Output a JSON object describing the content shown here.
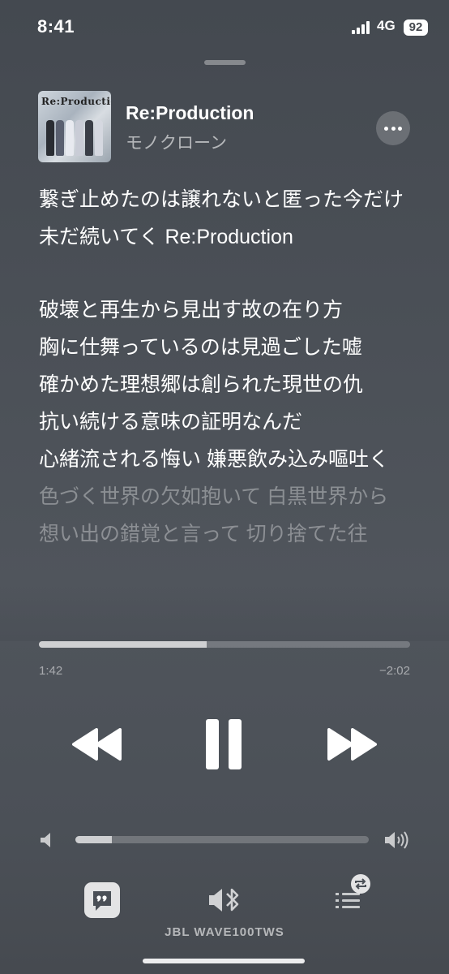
{
  "status_bar": {
    "time": "8:41",
    "network": "4G",
    "battery": "92"
  },
  "now_playing": {
    "artwork_text": "Re:Production",
    "title": "Re:Production",
    "artist": "モノクローン"
  },
  "lyrics": [
    {
      "text": "繋ぎ止めたのは譲れないと匿った今だけ",
      "state": "active"
    },
    {
      "text": "未だ続いてく Re:Production",
      "state": "active"
    },
    {
      "text": "",
      "state": "spacer"
    },
    {
      "text": "破壊と再生から見出す故の在り方",
      "state": "active"
    },
    {
      "text": "胸に仕舞っているのは見過ごした嘘",
      "state": "active"
    },
    {
      "text": "確かめた理想郷は創られた現世の仇",
      "state": "active"
    },
    {
      "text": "抗い続ける意味の証明なんだ",
      "state": "active"
    },
    {
      "text": "心緒流される悔い 嫌悪飲み込み嘔吐く",
      "state": "active"
    },
    {
      "text": "色づく世界の欠如抱いて 白黒世界から",
      "state": "dim"
    },
    {
      "text": "想い出の錯覚と言って 切り捨てた往",
      "state": "dim"
    }
  ],
  "playback": {
    "elapsed": "1:42",
    "remaining": "−2:02",
    "progress_fraction": 0.452,
    "volume_fraction": 0.125
  },
  "output": {
    "device": "JBL WAVE100TWS"
  },
  "icons": {
    "more": "more-icon",
    "previous": "backward-icon",
    "pause": "pause-icon",
    "next": "forward-icon",
    "volume_low": "speaker-low-icon",
    "volume_high": "speaker-high-icon",
    "lyrics": "lyrics-quote-icon",
    "airplay": "bluetooth-speaker-icon",
    "queue": "queue-list-icon",
    "repeat": "repeat-icon"
  }
}
